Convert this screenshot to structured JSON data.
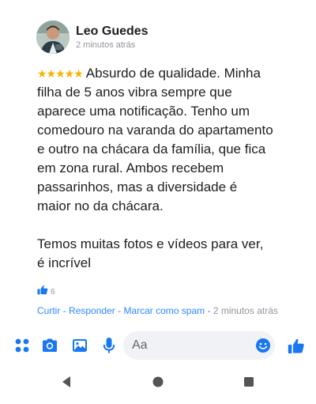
{
  "comment": {
    "author": "Leo Guedes",
    "timestamp": "2 minutos atrás",
    "rating_stars": "★★★★★",
    "rating": 5,
    "paragraphs": [
      "Absurdo de qualidade. Minha filha de 5 anos vibra sempre que aparece uma notificação. Tenho um comedouro na varanda do apartamento e outro na chácara da família, que fica em zona rural. Ambos recebem passarinhos, mas a diversidade é maior no da chácara.",
      "Temos muitas fotos e vídeos para ver, é incrível"
    ],
    "like_count": "6",
    "actions": {
      "like": "Curtir",
      "reply": "Responder",
      "report_spam": "Marcar como spam",
      "separator": "-",
      "time": "2 minutos atrás"
    }
  },
  "composer": {
    "placeholder": "Aa",
    "icons": [
      "menu-dots-icon",
      "camera-icon",
      "gallery-icon",
      "microphone-icon",
      "emoji-icon",
      "thumbs-up-icon"
    ]
  },
  "colors": {
    "accent": "#1877f2",
    "link": "#2d88ff",
    "secondary_text": "#90949c",
    "star": "#f5b400",
    "input_background": "#f0f2f5"
  },
  "navigation": {
    "icons": [
      "back-icon",
      "home-icon",
      "recents-icon"
    ]
  }
}
